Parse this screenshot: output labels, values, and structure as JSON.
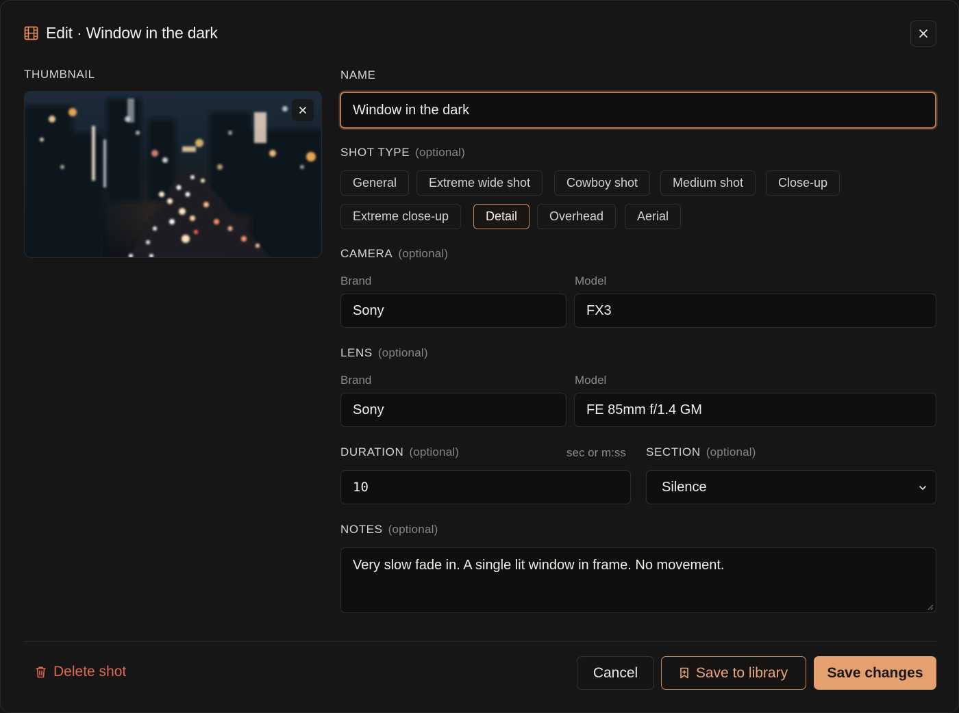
{
  "header": {
    "title": "Edit · Window in the dark",
    "icon": "film-icon",
    "close_icon": "close-icon"
  },
  "thumbnail": {
    "label": "THUMBNAIL",
    "remove_icon": "close-icon"
  },
  "name": {
    "label": "NAME",
    "value": "Window in the dark"
  },
  "shot_type": {
    "label": "SHOT TYPE",
    "optional": "(optional)",
    "options": [
      "General",
      "Extreme wide shot",
      "Cowboy shot",
      "Medium shot",
      "Close-up",
      "Extreme close-up",
      "Detail",
      "Overhead",
      "Aerial"
    ],
    "selected": "Detail"
  },
  "camera": {
    "label": "CAMERA",
    "optional": "(optional)",
    "brand_label": "Brand",
    "brand_value": "Sony",
    "model_label": "Model",
    "model_value": "FX3"
  },
  "lens": {
    "label": "LENS",
    "optional": "(optional)",
    "brand_label": "Brand",
    "brand_value": "Sony",
    "model_label": "Model",
    "model_value": "FE 85mm f/1.4 GM"
  },
  "duration": {
    "label": "DURATION",
    "optional": "(optional)",
    "hint": "sec or m:ss",
    "value": "10"
  },
  "section": {
    "label": "SECTION",
    "optional": "(optional)",
    "value": "Silence"
  },
  "notes": {
    "label": "NOTES",
    "optional": "(optional)",
    "value": "Very slow fade in. A single lit window in frame. No movement."
  },
  "footer": {
    "delete_label": "Delete shot",
    "cancel_label": "Cancel",
    "library_label": "Save to library",
    "save_label": "Save changes"
  },
  "colors": {
    "accent": "#e4a06f",
    "accent_border": "#c88a5c",
    "danger": "#d96a55",
    "background": "#161616"
  }
}
